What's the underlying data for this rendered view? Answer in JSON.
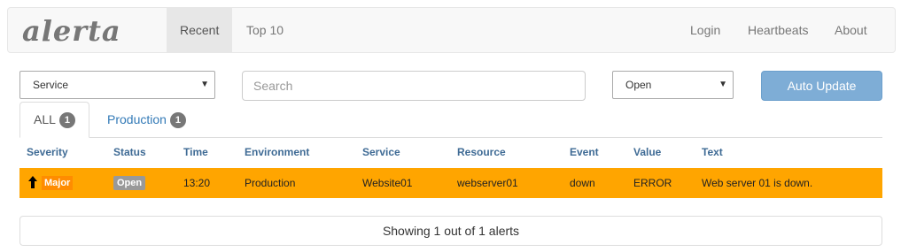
{
  "navbar": {
    "brand": "alerta",
    "left_items": [
      {
        "label": "Recent",
        "active": true
      },
      {
        "label": "Top 10",
        "active": false
      }
    ],
    "right_items": [
      {
        "label": "Login"
      },
      {
        "label": "Heartbeats"
      },
      {
        "label": "About"
      }
    ]
  },
  "filters": {
    "group_select": {
      "value": "Service"
    },
    "search": {
      "placeholder": "Search",
      "value": ""
    },
    "status_select": {
      "value": "Open"
    },
    "auto_update_label": "Auto Update"
  },
  "tabs": [
    {
      "label": "ALL",
      "count": "1",
      "active": true
    },
    {
      "label": "Production",
      "count": "1",
      "active": false
    }
  ],
  "table": {
    "columns": [
      "Severity",
      "Status",
      "Time",
      "Environment",
      "Service",
      "Resource",
      "Event",
      "Value",
      "Text"
    ],
    "rows": [
      {
        "severity": "Major",
        "status": "Open",
        "time": "13:20",
        "environment": "Production",
        "service": "Website01",
        "resource": "webserver01",
        "event": "down",
        "value": "ERROR",
        "text": "Web server 01 is down.",
        "row_color": "#ffa500"
      }
    ]
  },
  "footer": {
    "summary": "Showing 1 out of 1 alerts"
  },
  "colors": {
    "accent": "#7eadd6",
    "major": "#ffa500",
    "link": "#337ab7"
  },
  "icons": {
    "severity_trend": "arrow-up-icon",
    "select_caret": "caret-down-icon"
  }
}
